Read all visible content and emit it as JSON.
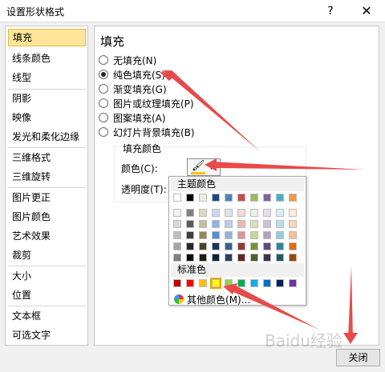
{
  "window": {
    "title": "设置形状格式",
    "help_glyph": "?",
    "close_glyph": "✕"
  },
  "sidebar": {
    "items": [
      {
        "label": "填充",
        "selected": true
      },
      {
        "label": "线条颜色"
      },
      {
        "label": "线型"
      },
      {
        "label": "阴影"
      },
      {
        "label": "映像"
      },
      {
        "label": "发光和柔化边缘"
      },
      {
        "label": "三维格式"
      },
      {
        "label": "三维旋转"
      },
      {
        "label": "图片更正"
      },
      {
        "label": "图片颜色"
      },
      {
        "label": "艺术效果"
      },
      {
        "label": "裁剪"
      },
      {
        "label": "大小"
      },
      {
        "label": "位置"
      },
      {
        "label": "文本框"
      },
      {
        "label": "可选文字"
      }
    ]
  },
  "panel": {
    "title": "填充",
    "fill_options": [
      {
        "label": "无填充(N)",
        "selected": false
      },
      {
        "label": "纯色填充(S)",
        "selected": true
      },
      {
        "label": "渐变填充(G)",
        "selected": false
      },
      {
        "label": "图片或纹理填充(P)",
        "selected": false
      },
      {
        "label": "图案填充(A)",
        "selected": false
      },
      {
        "label": "幻灯片背景填充(B)",
        "selected": false
      }
    ],
    "fill_color_group": {
      "title": "填充颜色",
      "color_label": "颜色(C):",
      "transparency_label": "透明度(T):",
      "current_color": "#ffc000"
    }
  },
  "color_picker": {
    "theme_header": "主题颜色",
    "standard_header": "标准色",
    "more_colors": "其他颜色(M)...",
    "theme_top": [
      "#ffffff",
      "#000000",
      "#eeece1",
      "#1f497d",
      "#4f81bd",
      "#c0504d",
      "#9bbb59",
      "#8064a2",
      "#4bacc6",
      "#f79646"
    ],
    "theme_shades": [
      [
        "#f2f2f2",
        "#7f7f7f",
        "#ddd9c3",
        "#c6d9f0",
        "#dbe5f1",
        "#f2dcdb",
        "#ebf1dd",
        "#e5e0ec",
        "#dbeef3",
        "#fdeada"
      ],
      [
        "#d8d8d8",
        "#595959",
        "#c4bd97",
        "#8db3e2",
        "#b8cce4",
        "#e5b9b7",
        "#d7e3bc",
        "#ccc1d9",
        "#b7dde8",
        "#fbd5b5"
      ],
      [
        "#bfbfbf",
        "#3f3f3f",
        "#938953",
        "#548dd4",
        "#95b3d7",
        "#d99694",
        "#c3d69b",
        "#b2a2c7",
        "#92cddc",
        "#fac08f"
      ],
      [
        "#a5a5a5",
        "#262626",
        "#494429",
        "#17365d",
        "#366092",
        "#953734",
        "#76923c",
        "#5f497a",
        "#31859b",
        "#e36c09"
      ],
      [
        "#7f7f7f",
        "#0c0c0c",
        "#1d1b10",
        "#0f243e",
        "#244061",
        "#632423",
        "#4f6128",
        "#3f3151",
        "#205867",
        "#974806"
      ]
    ],
    "standard": [
      "#c00000",
      "#ff0000",
      "#ffc000",
      "#ffff00",
      "#92d050",
      "#00b050",
      "#00b0f0",
      "#0070c0",
      "#002060",
      "#7030a0"
    ],
    "selected_standard_index": 3
  },
  "footer": {
    "close_label": "关闭"
  },
  "watermark": "Baidu经验",
  "colors": {
    "highlight": "#ffe59a",
    "arrow": "#e84a4a"
  }
}
